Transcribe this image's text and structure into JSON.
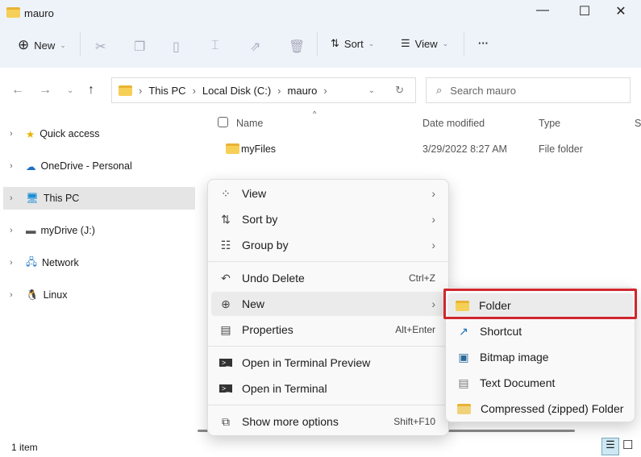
{
  "window": {
    "title": "mauro",
    "minimize": "—",
    "maximize": "☐",
    "close": "✕"
  },
  "toolbar": {
    "new": "New",
    "sort": "Sort",
    "view": "View",
    "more": "···"
  },
  "address": {
    "crumbs": [
      "This PC",
      "Local Disk (C:)",
      "mauro"
    ],
    "search_placeholder": "Search mauro"
  },
  "sidebar": {
    "items": [
      {
        "label": "Quick access"
      },
      {
        "label": "OneDrive - Personal"
      },
      {
        "label": "This PC"
      },
      {
        "label": "myDrive (J:)"
      },
      {
        "label": "Network"
      },
      {
        "label": "Linux"
      }
    ]
  },
  "columns": {
    "name": "Name",
    "date": "Date modified",
    "type": "Type",
    "size": "S"
  },
  "files": [
    {
      "name": "myFiles",
      "date": "3/29/2022 8:27 AM",
      "type": "File folder"
    }
  ],
  "context_menu": {
    "items": [
      {
        "label": "View"
      },
      {
        "label": "Sort by"
      },
      {
        "label": "Group by"
      },
      {
        "label": "Undo Delete",
        "shortcut": "Ctrl+Z"
      },
      {
        "label": "New"
      },
      {
        "label": "Properties",
        "shortcut": "Alt+Enter"
      },
      {
        "label": "Open in Terminal Preview"
      },
      {
        "label": "Open in Terminal"
      },
      {
        "label": "Show more options",
        "shortcut": "Shift+F10"
      }
    ]
  },
  "new_submenu": {
    "items": [
      {
        "label": "Folder"
      },
      {
        "label": "Shortcut"
      },
      {
        "label": "Bitmap image"
      },
      {
        "label": "Text Document"
      },
      {
        "label": "Compressed (zipped) Folder"
      }
    ]
  },
  "status": {
    "count": "1 item"
  },
  "colors": {
    "highlight": "#d0262f",
    "folder": "#f6cf57"
  }
}
